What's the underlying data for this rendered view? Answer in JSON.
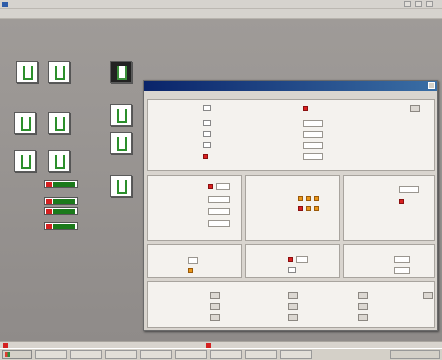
{
  "window": {
    "title": ""
  },
  "menu": [],
  "dialog": {
    "title": "",
    "head": ""
  },
  "statusbar": {
    "left": "",
    "center": "",
    "right": ""
  },
  "taskbar": {
    "start": "",
    "tasks": [
      "",
      "",
      "",
      "",
      "",
      "",
      "",
      ""
    ],
    "clock": ""
  }
}
